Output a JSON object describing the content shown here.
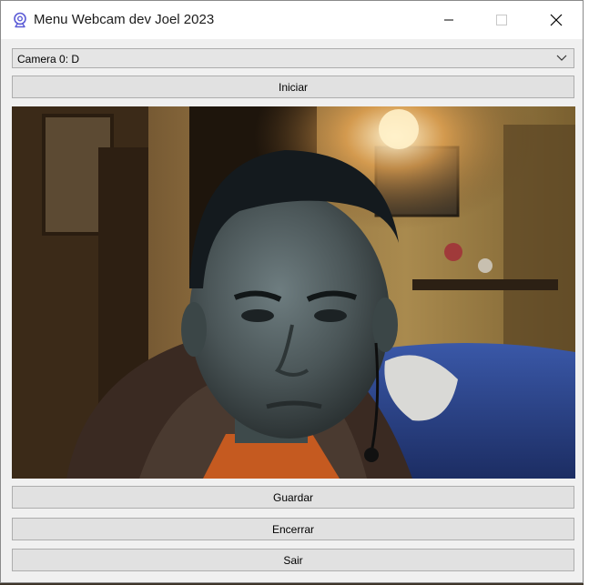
{
  "window": {
    "title": "Menu Webcam dev Joel 2023",
    "icon": "webcam-icon"
  },
  "camera_select": {
    "selected": "Camera 0: D"
  },
  "buttons": {
    "start": "Iniciar",
    "save": "Guardar",
    "stop": "Encerrar",
    "exit": "Sair"
  },
  "colors": {
    "window_bg": "#f0f0f0",
    "button_bg": "#e1e1e1",
    "icon_accent": "#5b5bd6"
  }
}
